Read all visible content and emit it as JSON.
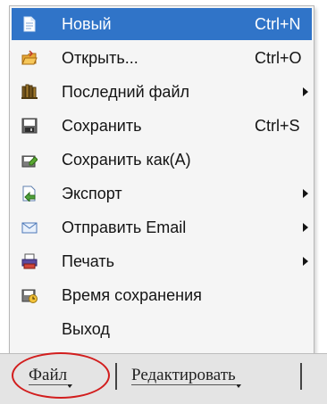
{
  "menu": {
    "items": [
      {
        "label": "Новый",
        "shortcut": "Ctrl+N",
        "submenu": false,
        "icon": "new-document-icon",
        "selected": true
      },
      {
        "label": "Открыть...",
        "shortcut": "Ctrl+O",
        "submenu": false,
        "icon": "open-folder-icon"
      },
      {
        "label": "Последний файл",
        "shortcut": "",
        "submenu": true,
        "icon": "recent-files-icon"
      },
      {
        "label": "Сохранить",
        "shortcut": "Ctrl+S",
        "submenu": false,
        "icon": "save-icon"
      },
      {
        "label": "Сохранить как(A)",
        "shortcut": "",
        "submenu": false,
        "icon": "save-as-icon"
      },
      {
        "label": "Экспорт",
        "shortcut": "",
        "submenu": true,
        "icon": "export-icon"
      },
      {
        "label": "Отправить Email",
        "shortcut": "",
        "submenu": true,
        "icon": "email-icon"
      },
      {
        "label": "Печать",
        "shortcut": "",
        "submenu": true,
        "icon": "print-icon"
      },
      {
        "label": "Время сохранения",
        "shortcut": "",
        "submenu": false,
        "icon": "autosave-clock-icon"
      },
      {
        "label": "Выход",
        "shortcut": "",
        "submenu": false,
        "icon": ""
      }
    ]
  },
  "menubar": {
    "items": [
      {
        "label": "Файл",
        "active": true
      },
      {
        "label": "Редактировать",
        "active": false
      }
    ]
  },
  "colors": {
    "selection": "#3074c8",
    "highlight_circle": "#d21e1e"
  }
}
